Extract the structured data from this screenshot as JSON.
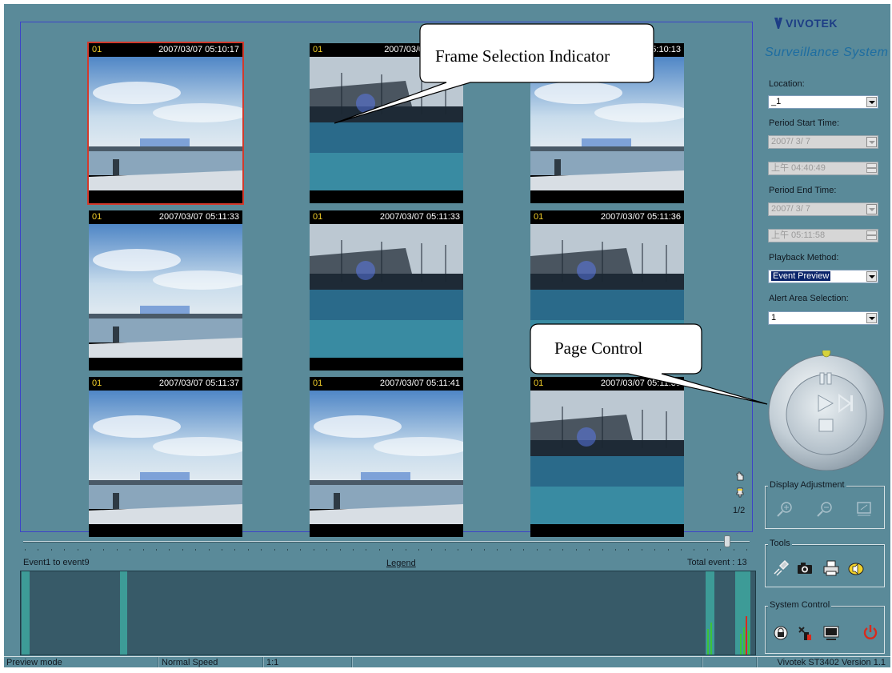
{
  "frames": [
    {
      "camera": "01",
      "timestamp": "2007/03/07 05:10:17",
      "scene": "harbor",
      "selected": true
    },
    {
      "camera": "01",
      "timestamp": "2007/03/07 05:10:1",
      "scene": "dock",
      "selected": false
    },
    {
      "camera": "01",
      "timestamp": "2007/03/07 05:10:13",
      "scene": "harbor",
      "selected": false
    },
    {
      "camera": "01",
      "timestamp": "2007/03/07 05:11:33",
      "scene": "harbor",
      "selected": false
    },
    {
      "camera": "01",
      "timestamp": "2007/03/07 05:11:33",
      "scene": "dock",
      "selected": false
    },
    {
      "camera": "01",
      "timestamp": "2007/03/07 05:11:36",
      "scene": "dock",
      "selected": false
    },
    {
      "camera": "01",
      "timestamp": "2007/03/07 05:11:37",
      "scene": "harbor",
      "selected": false
    },
    {
      "camera": "01",
      "timestamp": "2007/03/07 05:11:41",
      "scene": "harbor",
      "selected": false
    },
    {
      "camera": "01",
      "timestamp": "2007/03/07 05:11:38",
      "scene": "dock",
      "selected": false
    }
  ],
  "callouts": {
    "frame_selection": "Frame Selection Indicator",
    "page_control": "Page Control"
  },
  "pager": {
    "page": "1/2"
  },
  "timeline": {
    "range_label": "Event1 to event9",
    "legend_label": "Legend",
    "total_label": "Total event : 13",
    "slider_position": 0.97
  },
  "brand": {
    "logo": "VIVOTEK",
    "subtitle": "Surveillance System"
  },
  "sidebar": {
    "location_label": "Location:",
    "location_value": "_1",
    "period_start_label": "Period Start Time:",
    "period_start_date": "2007/ 3/ 7",
    "period_start_time": "上午 04:40:49",
    "period_end_label": "Period End Time:",
    "period_end_date": "2007/ 3/ 7",
    "period_end_time": "上午 05:11:58",
    "playback_label": "Playback Method:",
    "playback_value": "Event Preview",
    "alert_label": "Alert Area Selection:",
    "alert_value": "1",
    "display_adjustment_title": "Display Adjustment",
    "tools_title": "Tools",
    "system_control_title": "System Control"
  },
  "status": {
    "mode": "Preview mode",
    "speed": "Normal Speed",
    "ratio": "1:1",
    "product": "Vivotek ST3402   Version 1.1"
  },
  "colors": {
    "background": "#5a8a99",
    "panel_border": "#3c43c8",
    "selection": "#d23a2c",
    "camera_id": "#f2cf2a",
    "event_bar": "#3d9b97",
    "timeline_bg": "#375a68"
  }
}
